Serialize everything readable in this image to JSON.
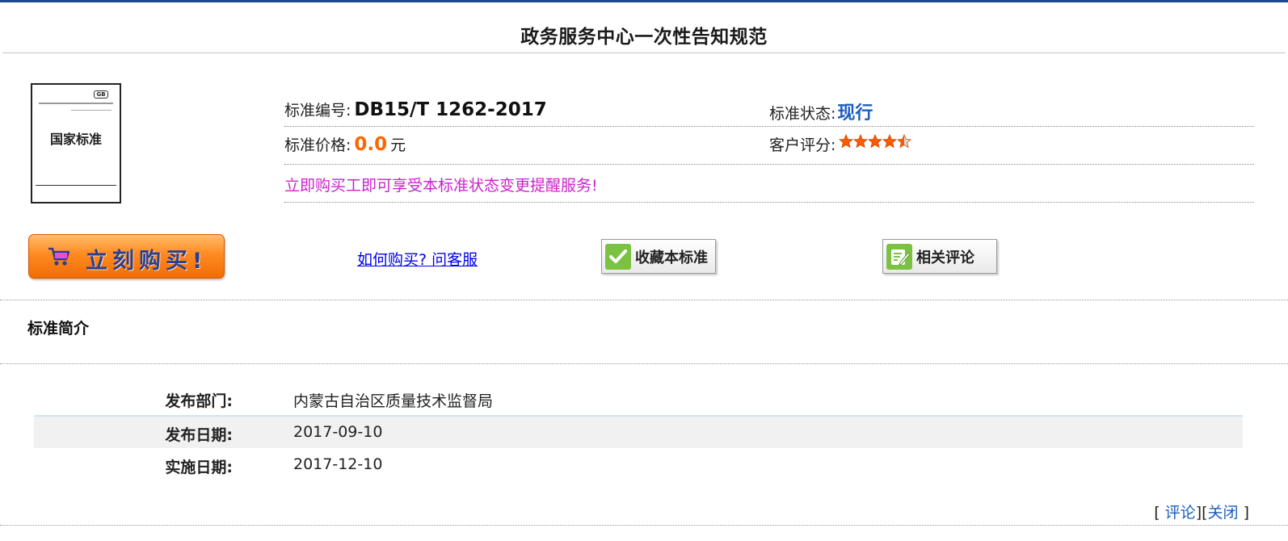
{
  "page": {
    "title": "政务服务中心一次性告知规范"
  },
  "cover": {
    "badge": "GB",
    "title": "国家标准"
  },
  "info": {
    "code_label": "标准编号:",
    "code_value": "DB15/T 1262-2017",
    "status_label": "标准状态:",
    "status_value": "现行",
    "price_label": "标准价格:",
    "price_value": "0.0",
    "price_unit": "元",
    "rating_label": "客户评分:",
    "rating_value": 4.5,
    "rating_max": 5,
    "notice": "立即购买工即可享受本标准状态变更提醒服务!"
  },
  "actions": {
    "buy_label": "立刻购买!",
    "help_link": "如何购买? 问客服",
    "favorite_label": "收藏本标准",
    "comment_label": "相关评论"
  },
  "intro": {
    "section_title": "标准简介",
    "rows": [
      {
        "label": "发布部门:",
        "value": "内蒙古自治区质量技术监督局"
      },
      {
        "label": "发布日期:",
        "value": "2017-09-10"
      },
      {
        "label": "实施日期:",
        "value": "2017-12-10"
      }
    ]
  },
  "footer": {
    "open_bracket": "[",
    "comment_link": "评论",
    "middle_bracket": "][",
    "close_link": "关闭",
    "close_bracket": "]"
  },
  "colors": {
    "accent_blue": "#1c5dbd",
    "price_orange": "#ff6600",
    "notice_magenta": "#cc22cc",
    "star_orange": "#ff5a00",
    "top_bar": "#1b4b8e"
  }
}
